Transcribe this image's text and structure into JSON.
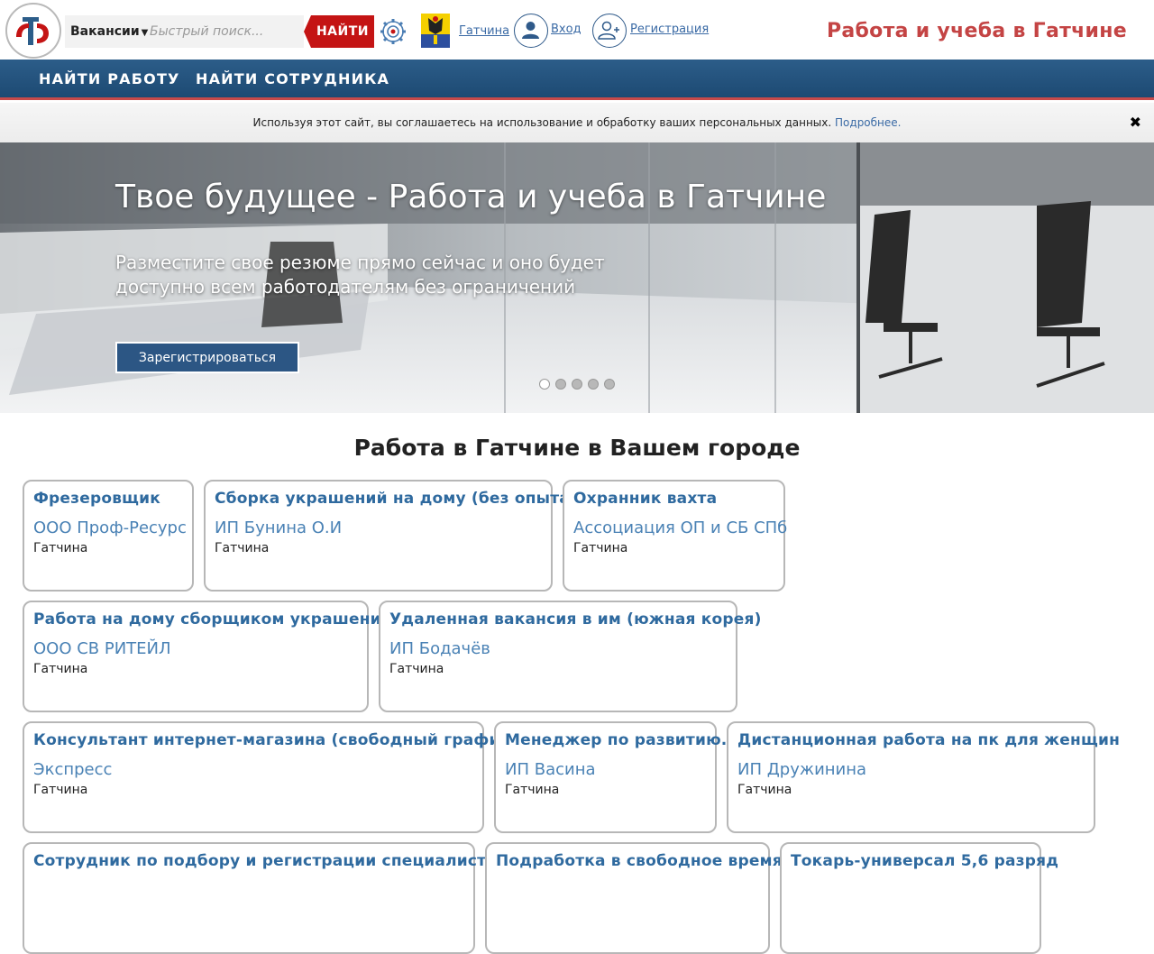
{
  "header": {
    "search_type": "Вакансии",
    "search_placeholder": "Быстрый поиск...",
    "search_button": "НАЙТИ",
    "city": "Гатчина",
    "login": "Вход",
    "register": "Регистрация",
    "site_title": "Работа и учеба в Гатчине"
  },
  "nav": {
    "items": [
      "НАЙТИ РАБОТУ",
      "НАЙТИ СОТРУДНИКА"
    ]
  },
  "cookie": {
    "text": "Используя этот сайт, вы соглашаетесь на использование и обработку ваших персональных данных.",
    "link": "Подробнее.",
    "close": "✖"
  },
  "hero": {
    "title": "Твое будущее - Работа и учеба в Гатчине",
    "subtitle": "Разместите свое резюме прямо сейчас и оно будет доступно всем работодателям без ограничений",
    "button": "Зарегистрироваться",
    "slides": 5,
    "active_slide": 1
  },
  "jobs": {
    "section_title": "Работа в Гатчине в Вашем городе",
    "rows": [
      [
        {
          "title": "Фрезеровщик",
          "company": "ООО Проф-Ресурс",
          "city": "Гатчина"
        },
        {
          "title": "Сборка украшений на дому (без опыта)",
          "company": "ИП Бунина О.И",
          "city": "Гатчина"
        },
        {
          "title": "Охранник вахта",
          "company": "Ассоциация ОП и СБ СПб",
          "city": "Гатчина"
        }
      ],
      [
        {
          "title": "Работа на дому сборщиком украшений",
          "company": "ООО СВ РИТЕЙЛ",
          "city": "Гатчина"
        },
        {
          "title": "Удаленная вакансия в им (южная корея)",
          "company": "ИП Бодачёв",
          "city": "Гатчина"
        }
      ],
      [
        {
          "title": "Консультант интернет-магазина (свободный график)",
          "company": "Экспресс",
          "city": "Гатчина"
        },
        {
          "title": "Менеджер по развитию.",
          "company": "ИП Васина",
          "city": "Гатчина"
        },
        {
          "title": "Дистанционная работа на пк для женщин",
          "company": "ИП Дружинина",
          "city": "Гатчина"
        }
      ],
      [
        {
          "title": "Сотрудник по подбору и регистрации специалистов",
          "company": "",
          "city": ""
        },
        {
          "title": "Подработка в свободное время",
          "company": "",
          "city": ""
        },
        {
          "title": "Токарь-универсал 5,6 разряд",
          "company": "",
          "city": ""
        }
      ]
    ]
  },
  "colors": {
    "brand_red": "#c41414",
    "nav_blue": "#2c5d89",
    "link_blue": "#3a6aa5",
    "title_red": "#c44444"
  }
}
